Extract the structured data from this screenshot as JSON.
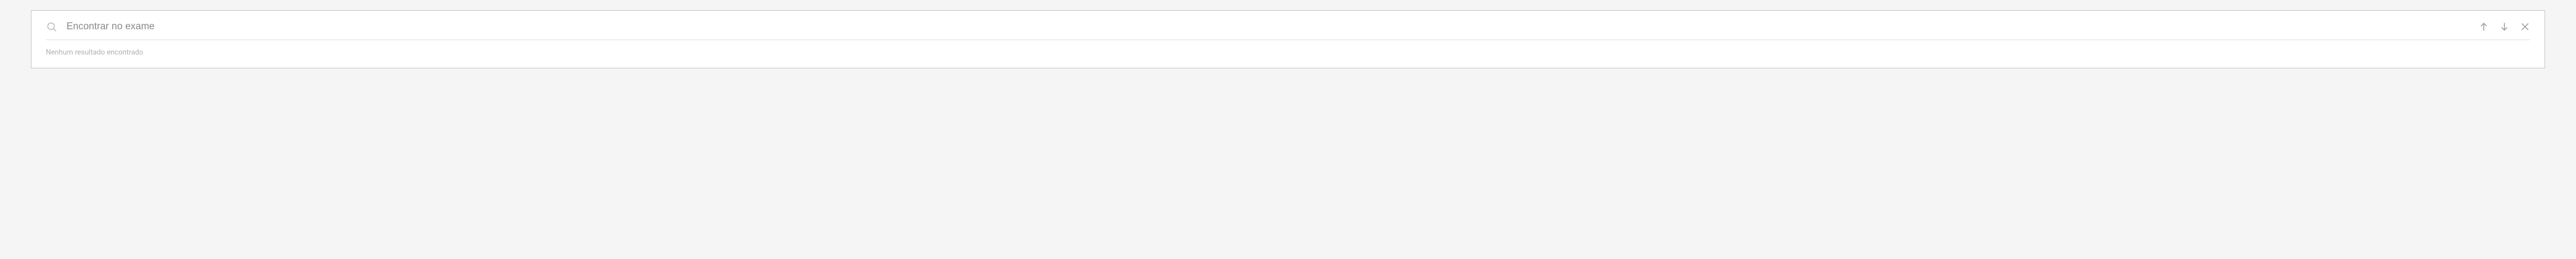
{
  "search": {
    "placeholder": "Encontrar no exame",
    "value": ""
  },
  "status": {
    "no_results": "Nenhum resultado encontrado"
  },
  "icons": {
    "search": "search-icon",
    "prev": "arrow-up-icon",
    "next": "arrow-down-icon",
    "close": "close-icon"
  }
}
